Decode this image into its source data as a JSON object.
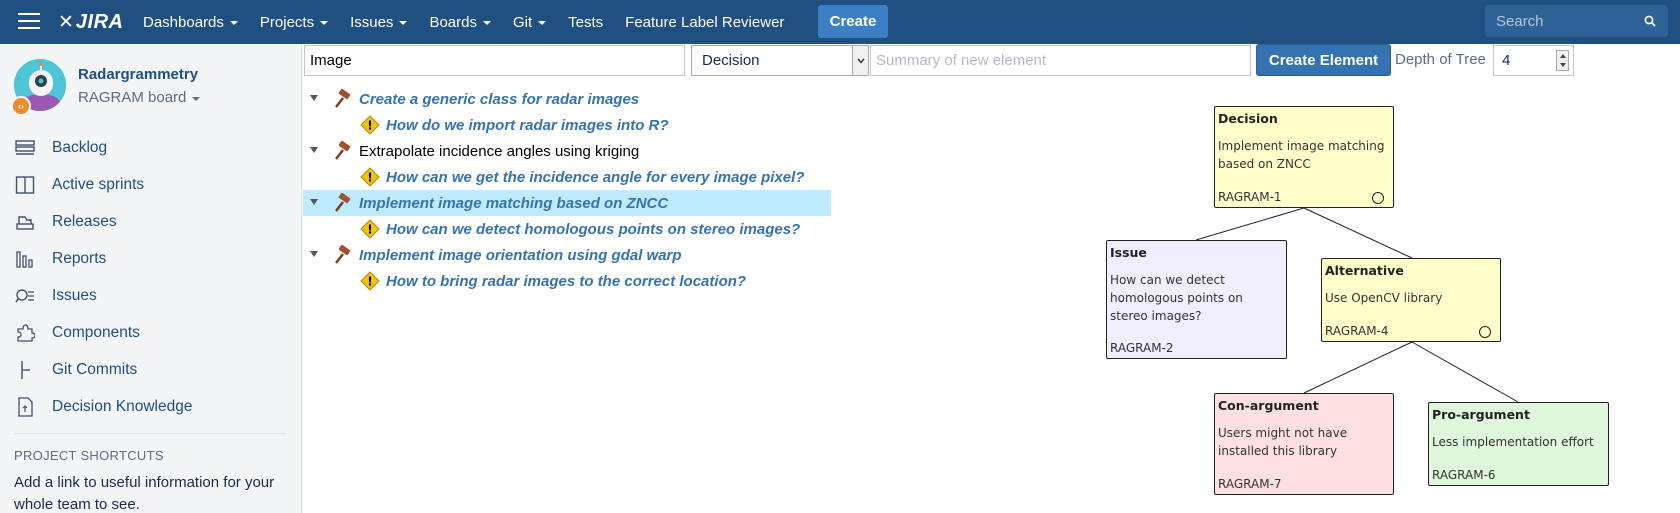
{
  "topbar": {
    "logo_text": "JIRA",
    "nav": [
      {
        "label": "Dashboards",
        "dropdown": true
      },
      {
        "label": "Projects",
        "dropdown": true
      },
      {
        "label": "Issues",
        "dropdown": true
      },
      {
        "label": "Boards",
        "dropdown": true
      },
      {
        "label": "Git",
        "dropdown": true
      },
      {
        "label": "Tests",
        "dropdown": false
      },
      {
        "label": "Feature Label Reviewer",
        "dropdown": false
      }
    ],
    "create_label": "Create",
    "search_placeholder": "Search",
    "bar_color": "#205081"
  },
  "sidebar": {
    "project_name": "Radargrammetry",
    "board_name": "RAGRAM board",
    "items": [
      {
        "label": "Backlog",
        "icon": "backlog-icon"
      },
      {
        "label": "Active sprints",
        "icon": "active-sprints-icon"
      },
      {
        "label": "Releases",
        "icon": "releases-icon"
      },
      {
        "label": "Reports",
        "icon": "reports-icon"
      },
      {
        "label": "Issues",
        "icon": "issues-icon"
      },
      {
        "label": "Components",
        "icon": "components-icon"
      },
      {
        "label": "Git Commits",
        "icon": "git-commits-icon"
      },
      {
        "label": "Decision Knowledge",
        "icon": "decision-knowledge-icon"
      }
    ],
    "shortcuts_title": "PROJECT SHORTCUTS",
    "shortcuts_text": "Add a link to useful information for your whole team to see."
  },
  "toolbar": {
    "filter_value": "Image",
    "type_selected": "Decision",
    "summary_placeholder": "Summary of new element",
    "create_element_label": "Create Element",
    "depth_label": "Depth of Tree",
    "depth_value": "4"
  },
  "tree": [
    {
      "label": "Create a generic class for radar images",
      "kind": "decision",
      "level": 0,
      "style": "link",
      "selected": false
    },
    {
      "label": "How do we import radar images into R?",
      "kind": "issue",
      "level": 1,
      "style": "link",
      "selected": false
    },
    {
      "label": "Extrapolate incidence angles using kriging",
      "kind": "decision",
      "level": 0,
      "style": "plain",
      "selected": false
    },
    {
      "label": "How can we get the incidence angle for every image pixel?",
      "kind": "issue",
      "level": 1,
      "style": "link",
      "selected": false
    },
    {
      "label": "Implement image matching based on ZNCC",
      "kind": "decision",
      "level": 0,
      "style": "link",
      "selected": true
    },
    {
      "label": "How can we detect homologous points on stereo images?",
      "kind": "issue",
      "level": 1,
      "style": "link",
      "selected": false
    },
    {
      "label": "Implement image orientation using gdal warp",
      "kind": "decision",
      "level": 0,
      "style": "link",
      "selected": false
    },
    {
      "label": "How to bring radar images to the correct location?",
      "kind": "issue",
      "level": 1,
      "style": "link",
      "selected": false
    }
  ],
  "graph": {
    "nodes": [
      {
        "id": "decision",
        "type": "Decision",
        "summary": "Implement image matching based on ZNCC",
        "key": "RAGRAM-1",
        "color": "#ffffcc",
        "circle": true
      },
      {
        "id": "issue",
        "type": "Issue",
        "summary": "How can we detect homologous points on stereo images?",
        "key": "RAGRAM-2",
        "color": "#f0eeff",
        "circle": false
      },
      {
        "id": "alternative",
        "type": "Alternative",
        "summary": "Use OpenCV library",
        "key": "RAGRAM-4",
        "color": "#ffffcc",
        "circle": true
      },
      {
        "id": "con",
        "type": "Con-argument",
        "summary": "Users might not have installed this library",
        "key": "RAGRAM-7",
        "color": "#ffe0e0",
        "circle": false
      },
      {
        "id": "pro",
        "type": "Pro-argument",
        "summary": "Less implementation effort",
        "key": "RAGRAM-6",
        "color": "#dff8dc",
        "circle": false
      }
    ],
    "edges": [
      {
        "from": "decision",
        "to": "issue"
      },
      {
        "from": "decision",
        "to": "alternative"
      },
      {
        "from": "alternative",
        "to": "con"
      },
      {
        "from": "alternative",
        "to": "pro"
      }
    ]
  }
}
